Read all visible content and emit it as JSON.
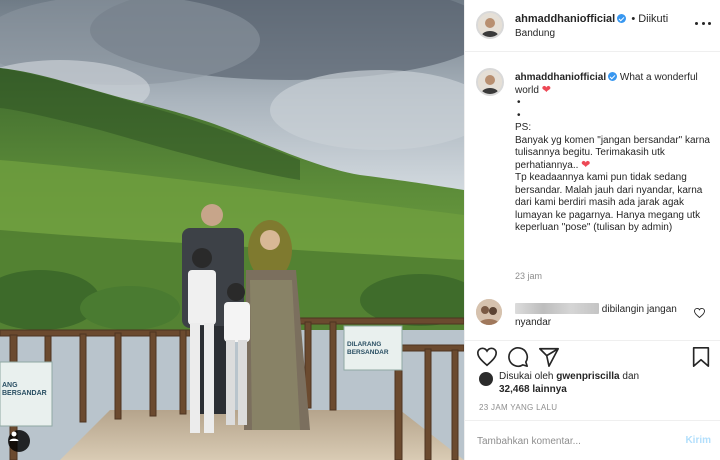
{
  "post": {
    "username": "ahmaddhaniofficial",
    "follow_status": "• Diikuti",
    "location": "Bandung",
    "photo_sign_text": "DILARANG BERSANDAR",
    "photo_sign_text_left": "ANG BERSANDAR"
  },
  "caption": {
    "username": "ahmaddhaniofficial",
    "line1": "What a wonderful world",
    "bullet1": "•",
    "bullet2": "•",
    "ps": "PS:",
    "para1": "Banyak yg komen \"jangan bersandar\" karna tulisannya begitu. Terimakasih utk perhatiannya..",
    "para2": "Tp keadaannya kami pun tidak sedang bersandar. Malah jauh dari nyandar, karna dari kami berdiri masih ada jarak agak lumayan ke pagarnya. Hanya megang utk keperluan \"pose\" (tulisan by admin)",
    "time": "23 jam"
  },
  "comment": {
    "text": "dibilangin jangan nyandar"
  },
  "likes": {
    "prefix": "Disukai oleh",
    "user": "gwenpriscilla",
    "connector": "dan",
    "count": "32,468 lainnya"
  },
  "post_time": "23 JAM YANG LALU",
  "add_comment": {
    "placeholder": "Tambahkan komentar...",
    "post_label": "Kirim"
  },
  "colors": {
    "accent": "#3897f0",
    "heart": "#ed4956",
    "muted": "#8e8e8e"
  }
}
